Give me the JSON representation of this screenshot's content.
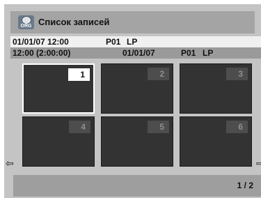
{
  "header": {
    "icon": "org-disc-icon",
    "icon_label": "ORG",
    "title": "Список записей"
  },
  "info": {
    "row1": {
      "datetime": "01/01/07 12:00",
      "program": "P01",
      "mode": "LP"
    },
    "row2": {
      "time": "12:00 (2:00:00)",
      "date": "01/01/07",
      "program": "P01",
      "mode": "LP"
    }
  },
  "thumbnails": [
    {
      "number": "1",
      "selected": true
    },
    {
      "number": "2",
      "selected": false
    },
    {
      "number": "3",
      "selected": false
    },
    {
      "number": "4",
      "selected": false
    },
    {
      "number": "5",
      "selected": false
    },
    {
      "number": "6",
      "selected": false
    }
  ],
  "navigation": {
    "prev_icon": "left-arrow-icon",
    "next_icon": "right-arrow-icon",
    "prev_symbol": "⇦",
    "next_symbol": "⇨"
  },
  "footer": {
    "page": "1 / 2"
  },
  "colors": {
    "background": "#c4c4c4",
    "thumbnail": "#333333",
    "selected_border": "#ffffff",
    "title_bar": "#a4a4a4"
  }
}
